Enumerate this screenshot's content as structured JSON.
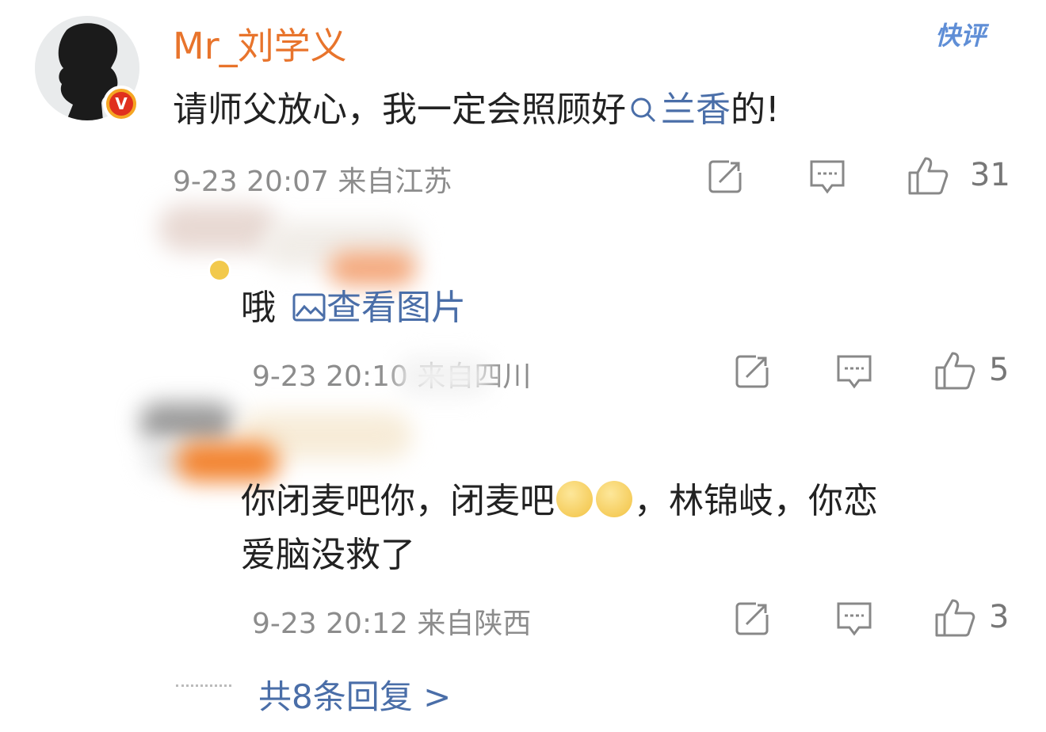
{
  "main_comment": {
    "username": "Mr_刘学义",
    "badge_letter": "V",
    "quick_comment": "快评",
    "text_before": "请师父放心，我一定会照顾好",
    "search_link": "兰香",
    "text_after": "的!",
    "meta": "9-23 20:07 来自江苏",
    "likes": "31",
    "accent_color": "#e8742c",
    "link_color": "#4a6ea8"
  },
  "replies": [
    {
      "text_before": "哦",
      "image_link": "查看图片",
      "meta": "9-23 20:10 来自四川",
      "likes": "5"
    },
    {
      "line1_a": "你闭麦吧你，闭麦吧",
      "line1_b": "，林锦岐，你恋",
      "line2": "爱脑没救了",
      "meta": "9-23 20:12 来自陕西",
      "likes": "3"
    }
  ],
  "more_replies": "共8条回复 >"
}
